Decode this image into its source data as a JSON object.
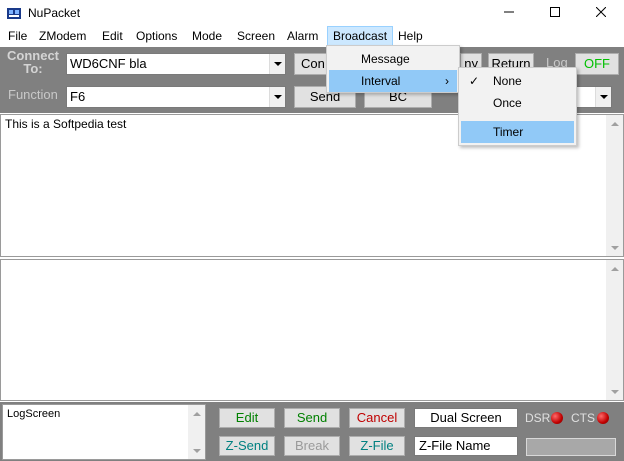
{
  "window": {
    "title": "NuPacket"
  },
  "menubar": {
    "items": [
      {
        "label": "File"
      },
      {
        "label": "ZModem"
      },
      {
        "label": "Edit"
      },
      {
        "label": "Options"
      },
      {
        "label": "Mode"
      },
      {
        "label": "Screen"
      },
      {
        "label": "Alarm"
      },
      {
        "label": "Broadcast"
      },
      {
        "label": "Help"
      }
    ]
  },
  "broadcast_menu": {
    "items": [
      {
        "label": "Message"
      },
      {
        "label": "Interval"
      }
    ]
  },
  "interval_submenu": {
    "items": [
      {
        "label": "None",
        "checked": true
      },
      {
        "label": "Once",
        "checked": false
      },
      {
        "label": "Timer",
        "checked": false
      }
    ]
  },
  "connect_row": {
    "label": "Connect To:",
    "value": "WD6CNF bla",
    "connect_button": "Con",
    "partial_button": "ny",
    "return_button": "Return",
    "log_label": "Log",
    "log_state": "OFF"
  },
  "function_row": {
    "label": "Function",
    "value": "F6",
    "send_button": "Send",
    "bc_button": "BC"
  },
  "upper_text": "This is a Softpedia test",
  "lower_text": "",
  "logscreen": {
    "text": "LogScreen"
  },
  "bottom": {
    "edit": "Edit",
    "send": "Send",
    "cancel": "Cancel",
    "dual_screen": "Dual Screen",
    "dsr": "DSR",
    "cts": "CTS",
    "zsend": "Z-Send",
    "break": "Break",
    "zfile": "Z-File",
    "zfile_name": "Z-File Name"
  },
  "colors": {
    "panel": "#808080",
    "menu_highlight": "#91c9f7",
    "log_off": "#00c000",
    "led": "#c00000"
  }
}
